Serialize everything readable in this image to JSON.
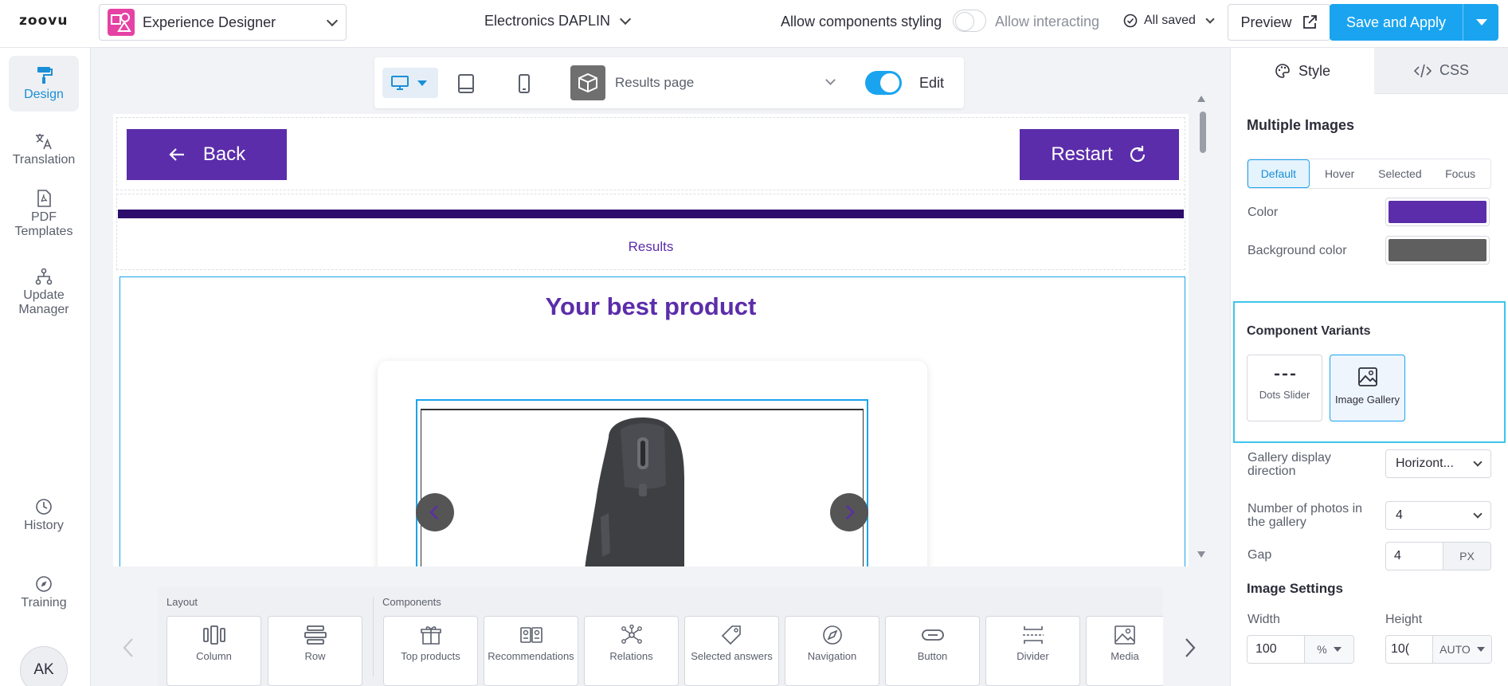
{
  "topbar": {
    "logo": "zoovu",
    "app_name": "Experience Designer",
    "project_name": "Electronics DAPLIN",
    "allow_styling_label": "Allow components styling",
    "allow_interacting_label": "Allow interacting",
    "saved_label": "All saved",
    "preview_label": "Preview",
    "save_label": "Save and Apply"
  },
  "sidebar": {
    "items": [
      {
        "label": "Design",
        "icon": "paint-roller-icon",
        "active": true
      },
      {
        "label": "Translation",
        "icon": "translate-icon"
      },
      {
        "label": "PDF Templates",
        "icon": "pdf-icon"
      },
      {
        "label": "Update Manager",
        "icon": "hierarchy-icon"
      },
      {
        "label": "History",
        "icon": "clock-icon"
      },
      {
        "label": "Training",
        "icon": "compass-icon"
      }
    ],
    "avatar": "AK"
  },
  "device_bar": {
    "page_name": "Results page",
    "edit_label": "Edit",
    "edit_enabled": true
  },
  "canvas": {
    "back_label": "Back",
    "restart_label": "Restart",
    "results_label": "Results",
    "title": "Your best product"
  },
  "dock": {
    "layout_label": "Layout",
    "components_label": "Components",
    "layout_items": [
      "Column",
      "Row"
    ],
    "component_items": [
      "Top products",
      "Recommendations",
      "Relations",
      "Selected answers",
      "Navigation",
      "Button",
      "Divider",
      "Media"
    ]
  },
  "panel": {
    "tab_style": "Style",
    "tab_css": "CSS",
    "section_title": "Multiple Images",
    "states": [
      "Default",
      "Hover",
      "Selected",
      "Focus"
    ],
    "color_label": "Color",
    "color_value": "#5b2daa",
    "bg_color_label": "Background color",
    "bg_color_value": "#5f5f5f",
    "variants_title": "Component Variants",
    "variant_dots": "Dots Slider",
    "variant_gallery": "Image Gallery",
    "gallery_dir_label": "Gallery display direction",
    "gallery_dir_value": "Horizont...",
    "photos_label": "Number of photos in the gallery",
    "photos_value": "4",
    "gap_label": "Gap",
    "gap_value": "4",
    "gap_unit": "PX",
    "image_settings_title": "Image Settings",
    "width_label": "Width",
    "width_value": "100",
    "width_unit": "%",
    "height_label": "Height",
    "height_value": "10(",
    "height_unit": "AUTO"
  },
  "colors": {
    "accent": "#1aa4ef",
    "brand_purple": "#5b2daa"
  }
}
